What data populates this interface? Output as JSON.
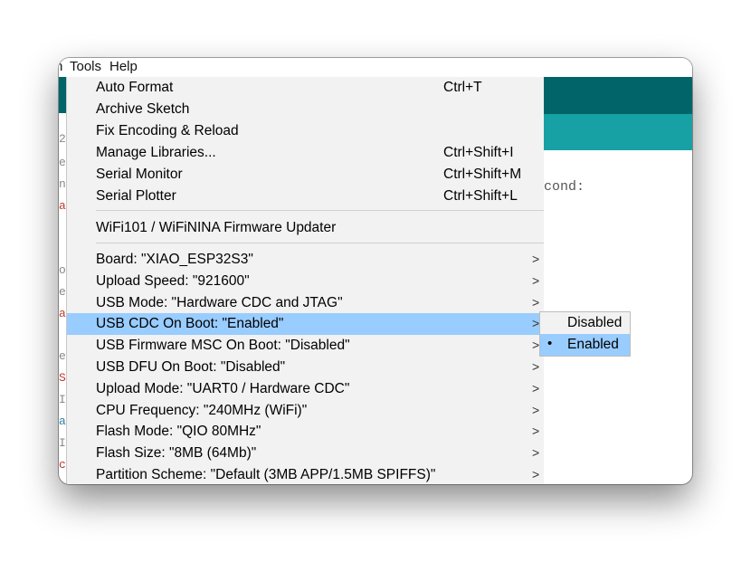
{
  "menubar": {
    "partial": "h",
    "tools": "Tools",
    "help": "Help"
  },
  "editor": {
    "visible_text": "cond:"
  },
  "gutter": [
    "2:",
    "e",
    "n:",
    "a.",
    "o",
    "e",
    "a.",
    "e.",
    "S",
    "I",
    "a:",
    "I",
    "c:"
  ],
  "menu": {
    "group1": [
      {
        "label": "Auto Format",
        "shortcut": "Ctrl+T"
      },
      {
        "label": "Archive Sketch",
        "shortcut": ""
      },
      {
        "label": "Fix Encoding & Reload",
        "shortcut": ""
      },
      {
        "label": "Manage Libraries...",
        "shortcut": "Ctrl+Shift+I"
      },
      {
        "label": "Serial Monitor",
        "shortcut": "Ctrl+Shift+M"
      },
      {
        "label": "Serial Plotter",
        "shortcut": "Ctrl+Shift+L"
      }
    ],
    "group2": [
      {
        "label": "WiFi101 / WiFiNINA Firmware Updater"
      }
    ],
    "group3": [
      {
        "label": "Board: \"XIAO_ESP32S3\"",
        "arrow": ">"
      },
      {
        "label": "Upload Speed: \"921600\"",
        "arrow": ">"
      },
      {
        "label": "USB Mode: \"Hardware CDC and JTAG\"",
        "arrow": ">"
      },
      {
        "label": "USB CDC On Boot: \"Enabled\"",
        "arrow": ">"
      },
      {
        "label": "USB Firmware MSC On Boot: \"Disabled\"",
        "arrow": ">"
      },
      {
        "label": "USB DFU On Boot: \"Disabled\"",
        "arrow": ">"
      },
      {
        "label": "Upload Mode: \"UART0 / Hardware CDC\"",
        "arrow": ">"
      },
      {
        "label": "CPU Frequency: \"240MHz (WiFi)\"",
        "arrow": ">"
      },
      {
        "label": "Flash Mode: \"QIO 80MHz\"",
        "arrow": ">"
      },
      {
        "label": "Flash Size: \"8MB (64Mb)\"",
        "arrow": ">"
      },
      {
        "label": "Partition Scheme: \"Default (3MB APP/1.5MB SPIFFS)\"",
        "arrow": ">"
      }
    ]
  },
  "submenu": {
    "options": [
      {
        "label": "Disabled",
        "bullet": ""
      },
      {
        "label": "Enabled",
        "bullet": "•"
      }
    ]
  },
  "colors": {
    "highlight": "#99ccff",
    "teal_dark": "#006468",
    "teal_light": "#17a1a5",
    "menu_bg": "#f2f2f2"
  }
}
